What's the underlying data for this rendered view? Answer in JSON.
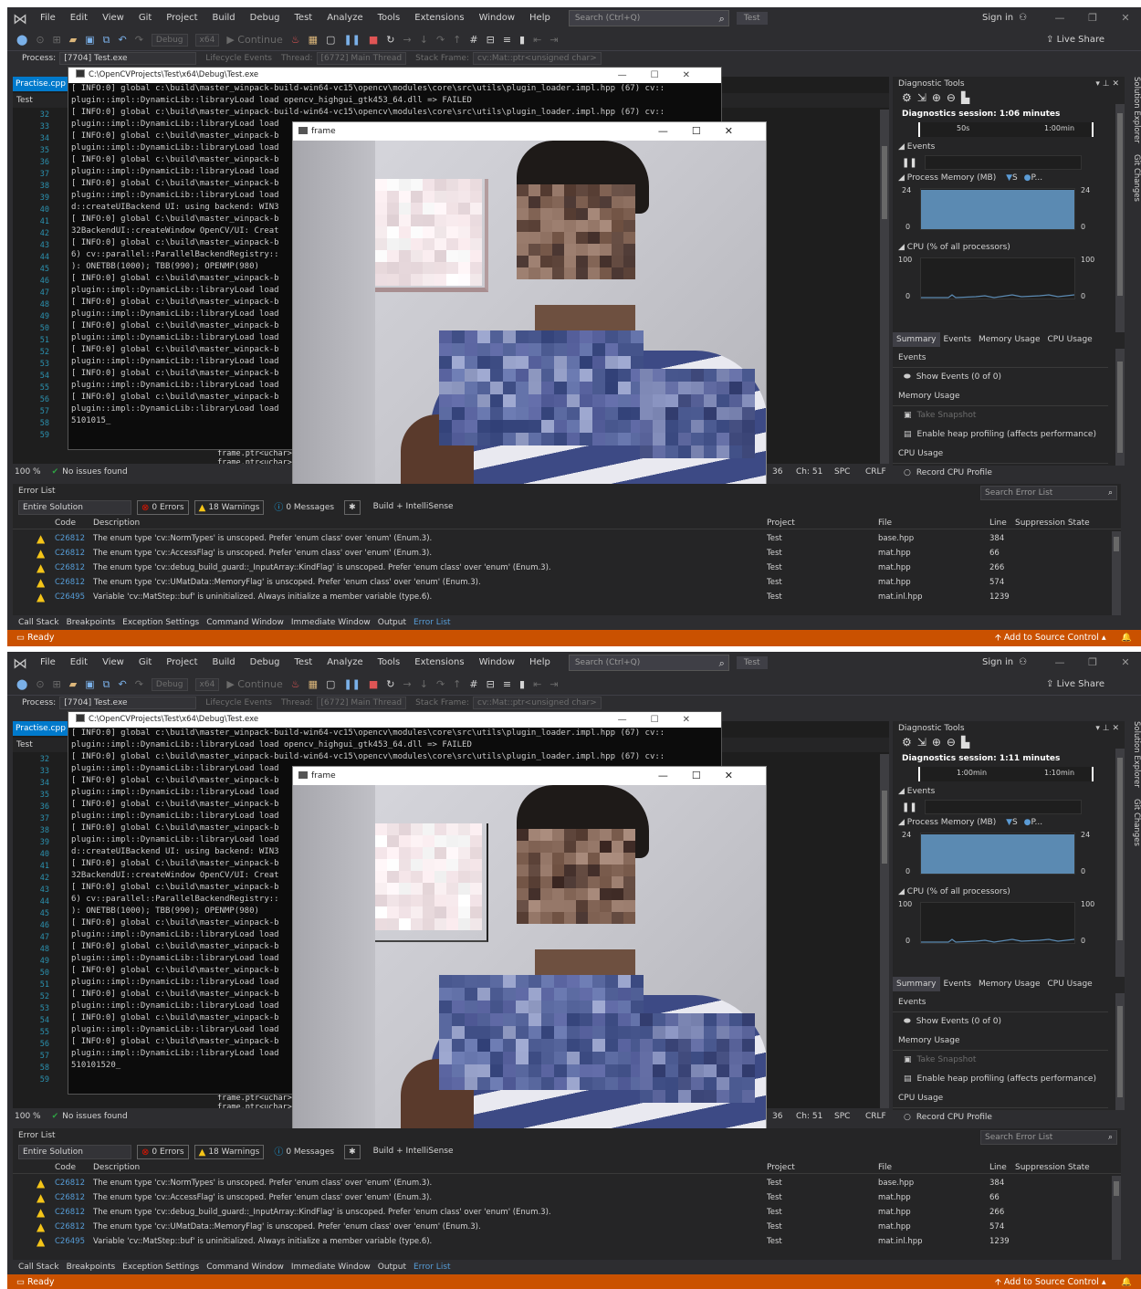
{
  "shots": [
    {
      "menu": [
        "File",
        "Edit",
        "View",
        "Git",
        "Project",
        "Build",
        "Debug",
        "Test",
        "Analyze",
        "Tools",
        "Extensions",
        "Window",
        "Help"
      ],
      "search_placeholder": "Search (Ctrl+Q)",
      "solution_name": "Test",
      "sign_in": "Sign in",
      "live_share": "Live Share",
      "toolbar_debug": "Debug",
      "toolbar_platform": "x64",
      "toolbar_continue": "Continue",
      "process_label": "Process:",
      "process_value": "[7704] Test.exe",
      "lifecycle_events": "Lifecycle Events",
      "thread_label": "Thread:",
      "thread_value": "[6772] Main Thread",
      "stack_frame_label": "Stack Frame:",
      "stack_frame_value": "cv::Mat::ptr<unsigned char>",
      "editor_tab": "Practise.cpp",
      "editor_nav": "Test",
      "line_numbers": [
        "32",
        "33",
        "34",
        "35",
        "36",
        "37",
        "38",
        "39",
        "40",
        "41",
        "42",
        "43",
        "44",
        "45",
        "46",
        "47",
        "48",
        "49",
        "50",
        "51",
        "52",
        "53",
        "54",
        "55",
        "56",
        "57",
        "58",
        "59"
      ],
      "behind_code": [
        "frame.ptr<uchar>",
        "frame.ptr<uchar>"
      ],
      "zoom": "100 %",
      "no_issues": "No issues found",
      "line_col": "36",
      "char_col": "Ch: 51",
      "spc": "SPC",
      "crlf": "CRLF",
      "console_title": "C:\\OpenCVProjects\\Test\\x64\\Debug\\Test.exe",
      "console_lines": [
        "[ INFO:0] global c:\\build\\master_winpack-build-win64-vc15\\opencv\\modules\\core\\src\\utils\\plugin_loader.impl.hpp (67) cv::",
        "plugin::impl::DynamicLib::libraryLoad load opencv_highgui_gtk453_64.dll => FAILED",
        "[ INFO:0] global c:\\build\\master_winpack-build-win64-vc15\\opencv\\modules\\core\\src\\utils\\plugin_loader.impl.hpp (67) cv::",
        "plugin::impl::DynamicLib::libraryLoad load",
        "[ INFO:0] global c:\\build\\master_winpack-b",
        "plugin::impl::DynamicLib::libraryLoad load",
        "[ INFO:0] global c:\\build\\master_winpack-b",
        "plugin::impl::DynamicLib::libraryLoad load",
        "[ INFO:0] global C:\\build\\master_winpack-b",
        "plugin::impl::DynamicLib::libraryLoad load",
        "d::createUIBackend UI: using backend: WIN3",
        "[ INFO:0] global C:\\build\\master_winpack-b",
        "32BackendUI::createWindow OpenCV/UI: Creat",
        "[ INFO:0] global c:\\build\\master_winpack-b",
        "6) cv::parallel::ParallelBackendRegistry::",
        "): ONETBB(1000); TBB(990); OPENMP(980)",
        "[ INFO:0] global c:\\build\\master_winpack-b",
        "plugin::impl::DynamicLib::libraryLoad load",
        "[ INFO:0] global c:\\build\\master_winpack-b",
        "plugin::impl::DynamicLib::libraryLoad load",
        "[ INFO:0] global c:\\build\\master_winpack-b",
        "plugin::impl::DynamicLib::libraryLoad load",
        "[ INFO:0] global c:\\build\\master_winpack-b",
        "plugin::impl::DynamicLib::libraryLoad load",
        "[ INFO:0] global c:\\build\\master_winpack-b",
        "plugin::impl::DynamicLib::libraryLoad load",
        "[ INFO:0] global c:\\build\\master_winpack-b",
        "plugin::impl::DynamicLib::libraryLoad load",
        "5101015_"
      ],
      "frame_title": "frame",
      "diag_title": "Diagnostic Tools",
      "diag_session": "Diagnostics session: 1:06 minutes",
      "timeline_labels": [
        "50s",
        "1:00min"
      ],
      "events_label": "Events",
      "process_memory_label": "Process Memory (MB)",
      "mem_legend": [
        "S",
        "P..."
      ],
      "mem_max": "24",
      "mem_min": "0",
      "mem_level": 0.97,
      "cpu_label": "CPU (% of all processors)",
      "cpu_max": "100",
      "cpu_min": "0",
      "diag_tabs": [
        "Summary",
        "Events",
        "Memory Usage",
        "CPU Usage"
      ],
      "summary": {
        "events_h": "Events",
        "show_events": "Show Events (0 of 0)",
        "memory_h": "Memory Usage",
        "take_snapshot": "Take Snapshot",
        "heap_profiling": "Enable heap profiling (affects performance)",
        "cpu_h": "CPU Usage",
        "record_cpu": "Record CPU Profile"
      },
      "side_tabs": [
        "Solution Explorer",
        "Git Changes"
      ],
      "error_list_title": "Error List",
      "scope": "Entire Solution",
      "errors_count": "0 Errors",
      "warnings_count": "18 Warnings",
      "messages_count": "0 Messages",
      "build_filter": "Build + IntelliSense",
      "search_error_list": "Search Error List",
      "err_columns": [
        "Code",
        "Description",
        "Project",
        "File",
        "Line",
        "Suppression State"
      ],
      "err_rows": [
        {
          "code": "C26812",
          "desc": "The enum type 'cv::NormTypes' is unscoped. Prefer 'enum class' over 'enum' (Enum.3).",
          "project": "Test",
          "file": "base.hpp",
          "line": "384"
        },
        {
          "code": "C26812",
          "desc": "The enum type 'cv::AccessFlag' is unscoped. Prefer 'enum class' over 'enum' (Enum.3).",
          "project": "Test",
          "file": "mat.hpp",
          "line": "66"
        },
        {
          "code": "C26812",
          "desc": "The enum type 'cv::debug_build_guard::_InputArray::KindFlag' is unscoped. Prefer 'enum class' over 'enum' (Enum.3).",
          "project": "Test",
          "file": "mat.hpp",
          "line": "266"
        },
        {
          "code": "C26812",
          "desc": "The enum type 'cv::UMatData::MemoryFlag' is unscoped. Prefer 'enum class' over 'enum' (Enum.3).",
          "project": "Test",
          "file": "mat.hpp",
          "line": "574"
        },
        {
          "code": "C26495",
          "desc": "Variable 'cv::MatStep::buf' is uninitialized. Always initialize a member variable (type.6).",
          "project": "Test",
          "file": "mat.inl.hpp",
          "line": "1239"
        }
      ],
      "bottom_tabs": [
        "Call Stack",
        "Breakpoints",
        "Exception Settings",
        "Command Window",
        "Immediate Window",
        "Output",
        "Error List"
      ],
      "status_ready": "Ready",
      "add_source_control": "Add to Source Control"
    },
    {
      "menu": [
        "File",
        "Edit",
        "View",
        "Git",
        "Project",
        "Build",
        "Debug",
        "Test",
        "Analyze",
        "Tools",
        "Extensions",
        "Window",
        "Help"
      ],
      "search_placeholder": "Search (Ctrl+Q)",
      "solution_name": "Test",
      "sign_in": "Sign in",
      "live_share": "Live Share",
      "toolbar_debug": "Debug",
      "toolbar_platform": "x64",
      "toolbar_continue": "Continue",
      "process_label": "Process:",
      "process_value": "[7704] Test.exe",
      "lifecycle_events": "Lifecycle Events",
      "thread_label": "Thread:",
      "thread_value": "[6772] Main Thread",
      "stack_frame_label": "Stack Frame:",
      "stack_frame_value": "cv::Mat::ptr<unsigned char>",
      "editor_tab": "Practise.cpp",
      "editor_nav": "Test",
      "line_numbers": [
        "32",
        "33",
        "34",
        "35",
        "36",
        "37",
        "38",
        "39",
        "40",
        "41",
        "42",
        "43",
        "44",
        "45",
        "46",
        "47",
        "48",
        "49",
        "50",
        "51",
        "52",
        "53",
        "54",
        "55",
        "56",
        "57",
        "58",
        "59"
      ],
      "behind_code": [
        "frame.ptr<uchar>",
        "frame.ptr<uchar>"
      ],
      "zoom": "100 %",
      "no_issues": "No issues found",
      "line_col": "36",
      "char_col": "Ch: 51",
      "spc": "SPC",
      "crlf": "CRLF",
      "console_title": "C:\\OpenCVProjects\\Test\\x64\\Debug\\Test.exe",
      "console_lines": [
        "[ INFO:0] global c:\\build\\master_winpack-build-win64-vc15\\opencv\\modules\\core\\src\\utils\\plugin_loader.impl.hpp (67) cv::",
        "plugin::impl::DynamicLib::libraryLoad load opencv_highgui_gtk453_64.dll => FAILED",
        "[ INFO:0] global c:\\build\\master_winpack-build-win64-vc15\\opencv\\modules\\core\\src\\utils\\plugin_loader.impl.hpp (67) cv::",
        "plugin::impl::DynamicLib::libraryLoad load",
        "[ INFO:0] global c:\\build\\master_winpack-b",
        "plugin::impl::DynamicLib::libraryLoad load",
        "[ INFO:0] global c:\\build\\master_winpack-b",
        "plugin::impl::DynamicLib::libraryLoad load",
        "[ INFO:0] global C:\\build\\master_winpack-b",
        "plugin::impl::DynamicLib::libraryLoad load",
        "d::createUIBackend UI: using backend: WIN3",
        "[ INFO:0] global C:\\build\\master_winpack-b",
        "32BackendUI::createWindow OpenCV/UI: Creat",
        "[ INFO:0] global c:\\build\\master_winpack-b",
        "6) cv::parallel::ParallelBackendRegistry::",
        "): ONETBB(1000); TBB(990); OPENMP(980)",
        "[ INFO:0] global c:\\build\\master_winpack-b",
        "plugin::impl::DynamicLib::libraryLoad load",
        "[ INFO:0] global c:\\build\\master_winpack-b",
        "plugin::impl::DynamicLib::libraryLoad load",
        "[ INFO:0] global c:\\build\\master_winpack-b",
        "plugin::impl::DynamicLib::libraryLoad load",
        "[ INFO:0] global c:\\build\\master_winpack-b",
        "plugin::impl::DynamicLib::libraryLoad load",
        "[ INFO:0] global c:\\build\\master_winpack-b",
        "plugin::impl::DynamicLib::libraryLoad load",
        "[ INFO:0] global c:\\build\\master_winpack-b",
        "plugin::impl::DynamicLib::libraryLoad load",
        "510101520_"
      ],
      "frame_title": "frame",
      "diag_title": "Diagnostic Tools",
      "diag_session": "Diagnostics session: 1:11 minutes",
      "timeline_labels": [
        "1:00min",
        "1:10min"
      ],
      "events_label": "Events",
      "process_memory_label": "Process Memory (MB)",
      "mem_legend": [
        "S",
        "P..."
      ],
      "mem_max": "24",
      "mem_min": "0",
      "mem_level": 0.97,
      "cpu_label": "CPU (% of all processors)",
      "cpu_max": "100",
      "cpu_min": "0",
      "diag_tabs": [
        "Summary",
        "Events",
        "Memory Usage",
        "CPU Usage"
      ],
      "summary": {
        "events_h": "Events",
        "show_events": "Show Events (0 of 0)",
        "memory_h": "Memory Usage",
        "take_snapshot": "Take Snapshot",
        "heap_profiling": "Enable heap profiling (affects performance)",
        "cpu_h": "CPU Usage",
        "record_cpu": "Record CPU Profile"
      },
      "side_tabs": [
        "Solution Explorer",
        "Git Changes"
      ],
      "error_list_title": "Error List",
      "scope": "Entire Solution",
      "errors_count": "0 Errors",
      "warnings_count": "18 Warnings",
      "messages_count": "0 Messages",
      "build_filter": "Build + IntelliSense",
      "search_error_list": "Search Error List",
      "err_columns": [
        "Code",
        "Description",
        "Project",
        "File",
        "Line",
        "Suppression State"
      ],
      "err_rows": [
        {
          "code": "C26812",
          "desc": "The enum type 'cv::NormTypes' is unscoped. Prefer 'enum class' over 'enum' (Enum.3).",
          "project": "Test",
          "file": "base.hpp",
          "line": "384"
        },
        {
          "code": "C26812",
          "desc": "The enum type 'cv::AccessFlag' is unscoped. Prefer 'enum class' over 'enum' (Enum.3).",
          "project": "Test",
          "file": "mat.hpp",
          "line": "66"
        },
        {
          "code": "C26812",
          "desc": "The enum type 'cv::debug_build_guard::_InputArray::KindFlag' is unscoped. Prefer 'enum class' over 'enum' (Enum.3).",
          "project": "Test",
          "file": "mat.hpp",
          "line": "266"
        },
        {
          "code": "C26812",
          "desc": "The enum type 'cv::UMatData::MemoryFlag' is unscoped. Prefer 'enum class' over 'enum' (Enum.3).",
          "project": "Test",
          "file": "mat.hpp",
          "line": "574"
        },
        {
          "code": "C26495",
          "desc": "Variable 'cv::MatStep::buf' is uninitialized. Always initialize a member variable (type.6).",
          "project": "Test",
          "file": "mat.inl.hpp",
          "line": "1239"
        }
      ],
      "bottom_tabs": [
        "Call Stack",
        "Breakpoints",
        "Exception Settings",
        "Command Window",
        "Immediate Window",
        "Output",
        "Error List"
      ],
      "status_ready": "Ready",
      "add_source_control": "Add to Source Control"
    }
  ]
}
